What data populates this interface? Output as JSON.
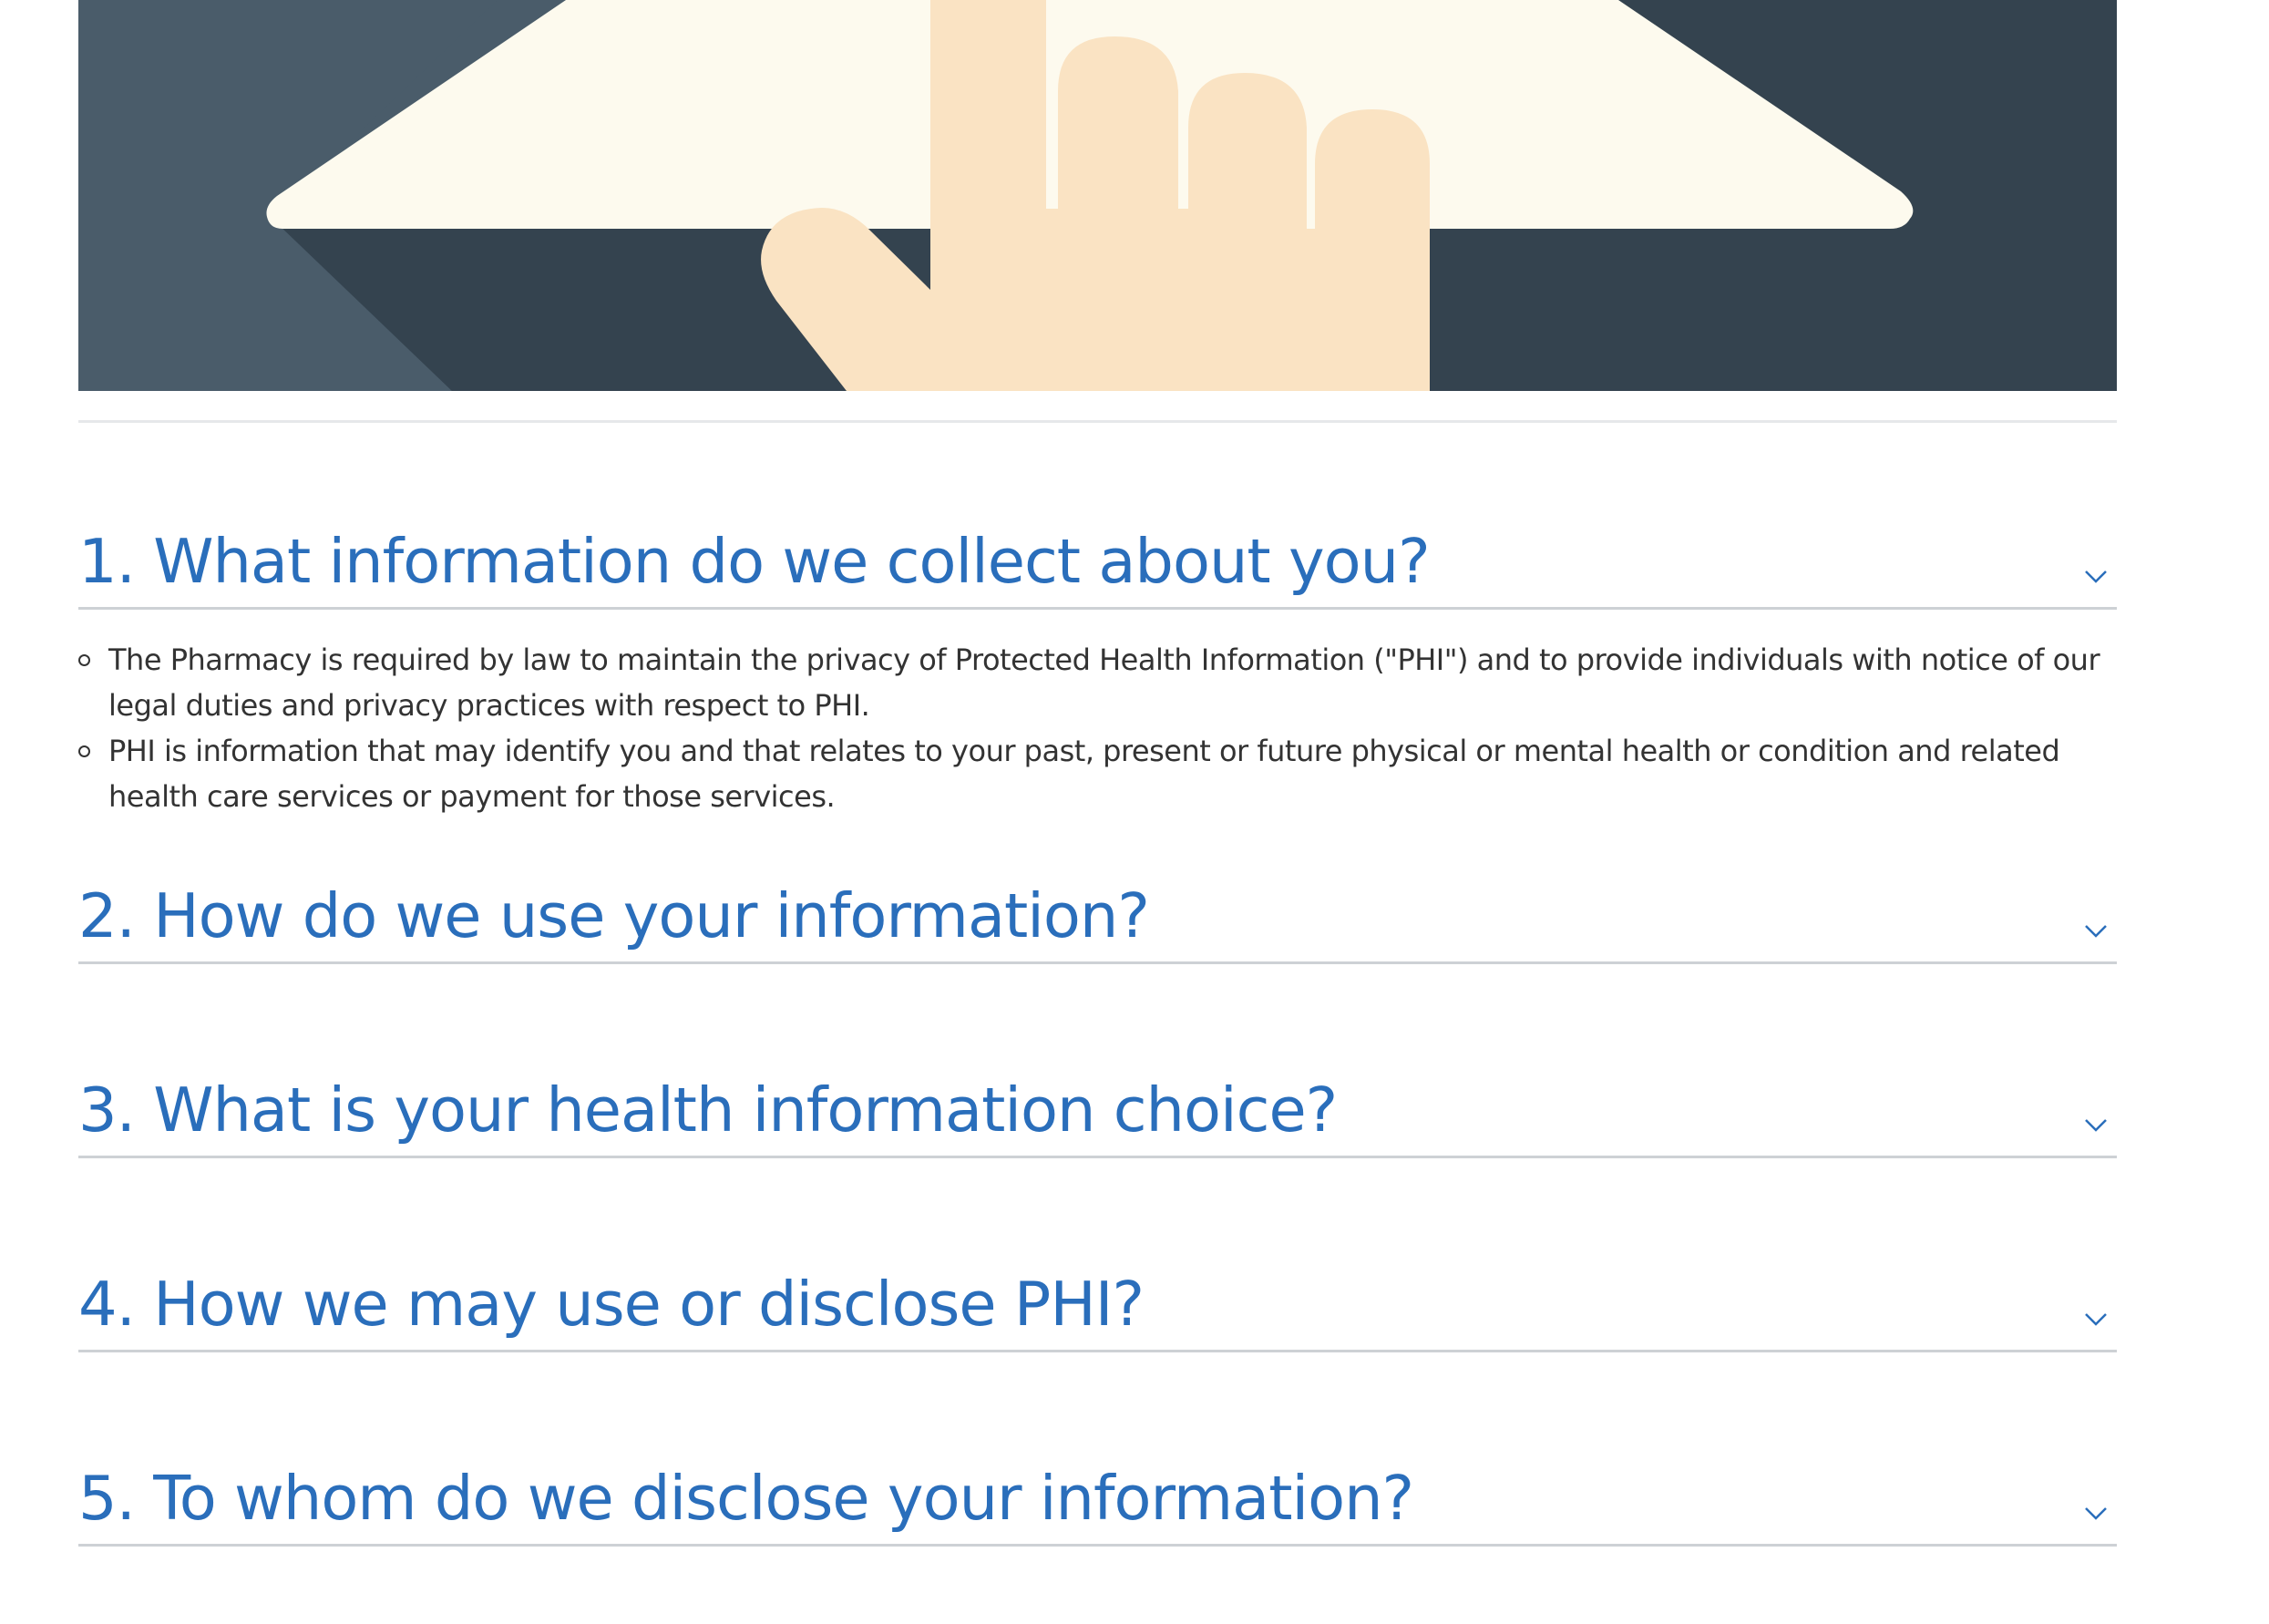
{
  "hero": {
    "image": "pointing-hand-on-tablet-illustration"
  },
  "accordion": {
    "sections": [
      {
        "title": "1. What information do we collect about you?",
        "expanded": true,
        "chevron": "chevron-down-icon",
        "items": [
          "The Pharmacy is required by law to maintain the privacy of Protected Health Information (\"PHI\") and to provide individuals with notice of our legal duties and privacy practices with respect to PHI.",
          "PHI is information that may identify you and that relates to your past, present or future physical or mental health or condition and related health care services or payment for those services."
        ]
      },
      {
        "title": "2. How do we use your information?",
        "expanded": false,
        "chevron": "chevron-down-icon"
      },
      {
        "title": "3. What is your health information choice?",
        "expanded": false,
        "chevron": "chevron-down-icon"
      },
      {
        "title": "4. How we may use or disclose PHI?",
        "expanded": false,
        "chevron": "chevron-down-icon"
      },
      {
        "title": "5. To whom do we disclose your information?",
        "expanded": false,
        "chevron": "chevron-down-icon"
      }
    ]
  },
  "colors": {
    "heading": "#2a6ebb",
    "body_text": "#333333",
    "divider": "#cdd1d5",
    "hero_dark": "#34434f",
    "hero_light": "#4a5c6a",
    "tablet": "#fdfaee",
    "hand": "#fae3c3"
  }
}
